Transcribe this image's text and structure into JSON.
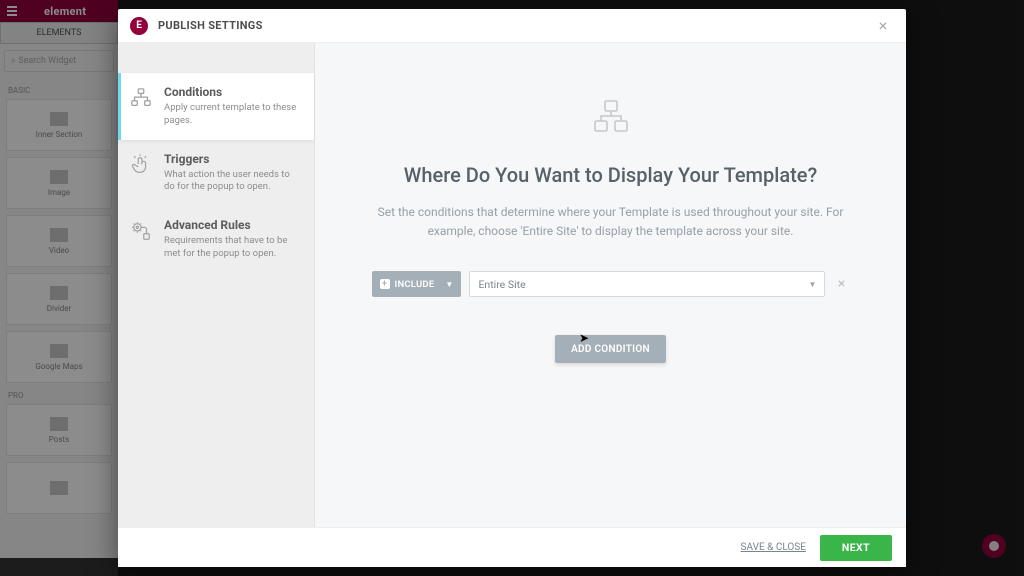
{
  "bg": {
    "brand": "element",
    "tab": "ELEMENTS",
    "search_placeholder": "Search Widget",
    "sections": {
      "basic": "BASIC",
      "pro": "PRO"
    },
    "widgets": {
      "inner_section": "Inner Section",
      "image": "Image",
      "video": "Video",
      "divider": "Divider",
      "google_maps": "Google Maps",
      "posts": "Posts"
    }
  },
  "modal": {
    "title": "PUBLISH SETTINGS",
    "sidebar": {
      "conditions": {
        "title": "Conditions",
        "desc": "Apply current template to these pages."
      },
      "triggers": {
        "title": "Triggers",
        "desc": "What action the user needs to do for the popup to open."
      },
      "advanced": {
        "title": "Advanced Rules",
        "desc": "Requirements that have to be met for the popup to open."
      }
    },
    "hero": {
      "title": "Where Do You Want to Display Your Template?",
      "desc": "Set the conditions that determine where your Template is used throughout your site. For example, choose 'Entire Site' to display the template across your site."
    },
    "condition": {
      "include_label": "INCLUDE",
      "selected": "Entire Site"
    },
    "add_condition": "ADD CONDITION",
    "footer": {
      "save_close": "SAVE & CLOSE",
      "next": "NEXT"
    }
  }
}
